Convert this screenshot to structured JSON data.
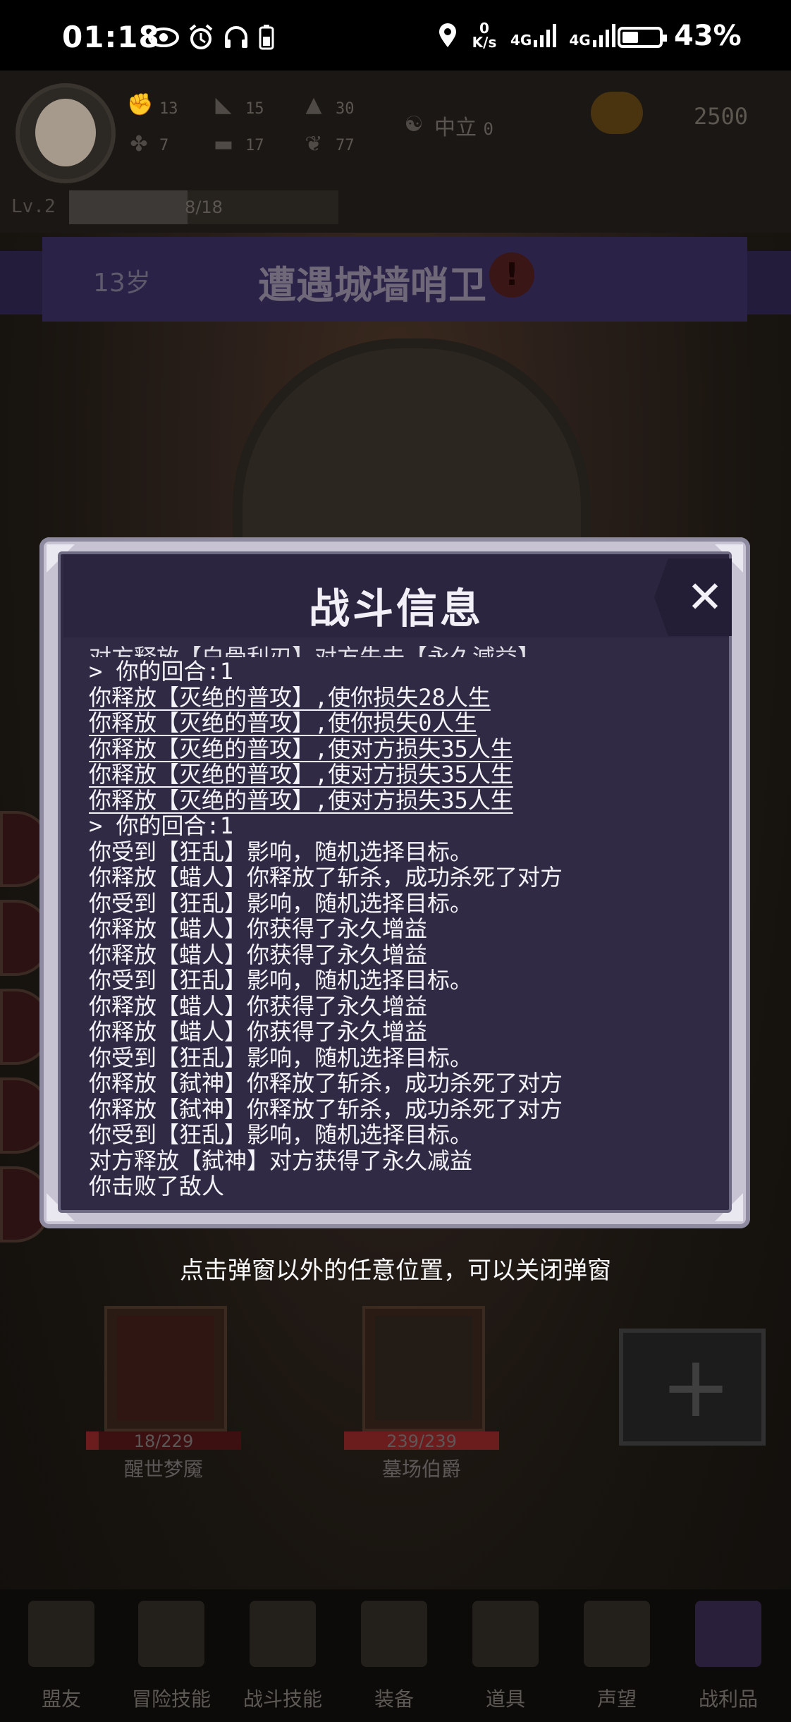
{
  "status_bar": {
    "time": "01:18",
    "net_speed_top": "0",
    "net_speed_unit": "K/s",
    "sim1": "4G",
    "sim2": "4G",
    "battery_percent": "43%",
    "battery_level": 0.43,
    "icons": [
      "eye-icon",
      "alarm-icon",
      "headset-icon",
      "phone-battery-icon",
      "location-icon"
    ]
  },
  "player": {
    "stats": [
      {
        "icon": "fist-icon",
        "value": "13"
      },
      {
        "icon": "boot-icon",
        "value": "15"
      },
      {
        "icon": "wizard-hat-icon",
        "value": "30"
      },
      {
        "icon": "clover-icon",
        "value": "7"
      },
      {
        "icon": "book-icon",
        "value": "17"
      },
      {
        "icon": "wings-icon",
        "value": "77"
      }
    ],
    "alignment_label": "中立",
    "alignment_value": "0",
    "gold": "2500",
    "level": "Lv.2",
    "xp_text": "8/18",
    "xp_fraction": 0.44
  },
  "banner": {
    "age": "13岁",
    "event": "遭遇城墙哨卫",
    "alert_symbol": "!"
  },
  "dialog": {
    "title": "战斗信息",
    "close_symbol": "✕",
    "log": [
      "对方释放【白骨利刃】对方失去【永久減益】",
      "> 你的回合:1",
      "你释放【灭绝的普攻】,使你损失28人生",
      "你释放【灭绝的普攻】,使你损失0人生",
      "你释放【灭绝的普攻】,使对方损失35人生",
      "你释放【灭绝的普攻】,使对方损失35人生",
      "你释放【灭绝的普攻】,使对方损失35人生",
      "> 你的回合:1",
      "你受到【狂乱】影响，随机选择目标。",
      "你释放【蜡人】你释放了斩杀，成功杀死了对方",
      "你受到【狂乱】影响，随机选择目标。",
      "你释放【蜡人】你获得了永久增益",
      "你释放【蜡人】你获得了永久增益",
      "你受到【狂乱】影响，随机选择目标。",
      "你释放【蜡人】你获得了永久增益",
      "你释放【蜡人】你获得了永久增益",
      "你受到【狂乱】影响，随机选择目标。",
      "你释放【弑神】你释放了斩杀，成功杀死了对方",
      "你释放【弑神】你释放了斩杀，成功杀死了对方",
      "你受到【狂乱】影响，随机选择目标。",
      "对方释放【弑神】对方获得了永久减益",
      "你击败了敌人"
    ]
  },
  "hint": "点击弹窗以外的任意位置，可以关闭弹窗",
  "party": [
    {
      "name": "醒世梦魇",
      "hp": "18/229",
      "hp_fraction": 0.08
    },
    {
      "name": "墓场伯爵",
      "hp": "239/239",
      "hp_fraction": 1.0
    }
  ],
  "add_symbol": "+",
  "nav": [
    {
      "label": "盟友",
      "icon": "handshake-icon"
    },
    {
      "label": "冒险技能",
      "icon": "spellbook-icon"
    },
    {
      "label": "战斗技能",
      "icon": "backpack-icon"
    },
    {
      "label": "装备",
      "icon": "crossed-swords-icon"
    },
    {
      "label": "道具",
      "icon": "potion-bag-icon"
    },
    {
      "label": "声望",
      "icon": "scroll-icon"
    },
    {
      "label": "战利品",
      "icon": "treasure-chest-icon"
    }
  ],
  "colors": {
    "dialog_frame": "#c7c3d2",
    "dialog_body": "#302a44",
    "banner": "#2b2247",
    "text": "#f4f3f8"
  }
}
